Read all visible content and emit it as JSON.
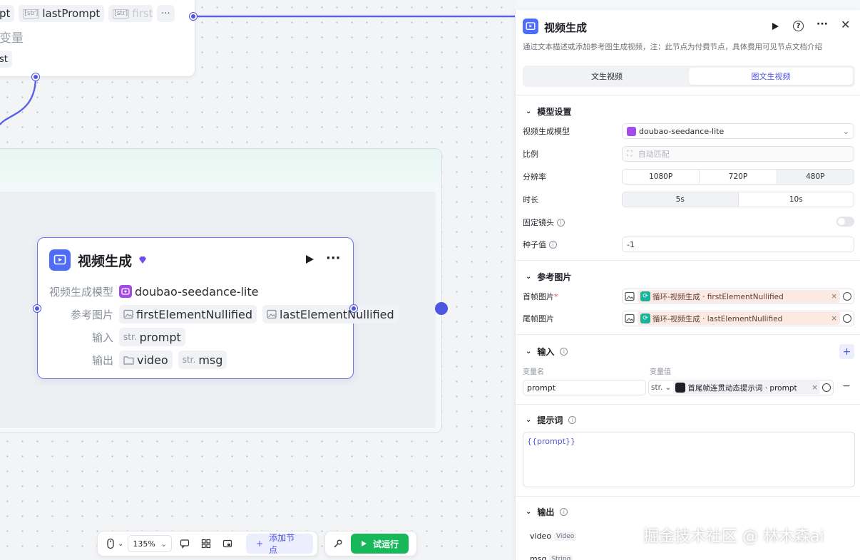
{
  "canvas": {
    "top_node": {
      "tags": [
        {
          "prefix": "",
          "text": "pt"
        },
        {
          "prefix": "[str]",
          "text": "lastPrompt"
        },
        {
          "prefix": "[str]",
          "text": "firstE"
        }
      ],
      "more": "···",
      "line2": "变量",
      "line3": "st"
    },
    "node": {
      "title": "视频生成",
      "more": "···",
      "rows": {
        "model_label": "视频生成模型",
        "model_value": "doubao-seedance-lite",
        "ref_label": "参考图片",
        "ref_values": [
          "firstElementNullified",
          "lastElementNullified"
        ],
        "input_label": "输入",
        "input_str": "str.",
        "input_value": "prompt",
        "output_label": "输出",
        "output_values": [
          "video",
          "msg"
        ],
        "output_str": "str."
      }
    }
  },
  "toolbar": {
    "zoom": "135%",
    "add_node": "添加节点",
    "test_run": "试运行"
  },
  "panel": {
    "title": "视频生成",
    "description": "通过文本描述或添加参考图生成视频，注：此节点为付费节点，具体费用可见节点文档介绍",
    "tabs": [
      "文生视频",
      "图文生视频"
    ],
    "model_section": {
      "title": "模型设置",
      "model_label": "视频生成模型",
      "model_value": "doubao-seedance-lite",
      "ratio_label": "比例",
      "ratio_value": "自动匹配",
      "resolution_label": "分辨率",
      "resolutions": [
        "1080P",
        "720P",
        "480P"
      ],
      "resolution_selected": "480P",
      "duration_label": "时长",
      "durations": [
        "5s",
        "10s"
      ],
      "duration_selected": "5s",
      "fixed_camera_label": "固定镜头",
      "fixed_camera_on": false,
      "seed_label": "种子值",
      "seed_value": "-1"
    },
    "ref_section": {
      "title": "参考图片",
      "first_label": "首帧图片",
      "first_value": "循环-视频生成 · firstElementNullified",
      "last_label": "尾帧图片",
      "last_value": "循环-视频生成 · lastElementNullified"
    },
    "input_section": {
      "title": "输入",
      "col_name": "变量名",
      "col_value": "变量值",
      "var_name": "prompt",
      "var_type": "str.",
      "var_ref": "首尾帧连贯动态提示词 · prompt"
    },
    "prompt_section": {
      "title": "提示词",
      "content": "{{prompt}}"
    },
    "output_section": {
      "title": "输出",
      "items": [
        {
          "name": "video",
          "type": "Video"
        },
        {
          "name": "msg",
          "type": "String"
        }
      ]
    }
  },
  "watermark": "掘金技术社区 @ 林木森ai",
  "colors": {
    "accent": "#4e55e0",
    "run_button": "#16b85a",
    "node_icon": "#4e6cf5",
    "loop_icon": "#19b39b",
    "model_icon": "#a34ce8"
  }
}
